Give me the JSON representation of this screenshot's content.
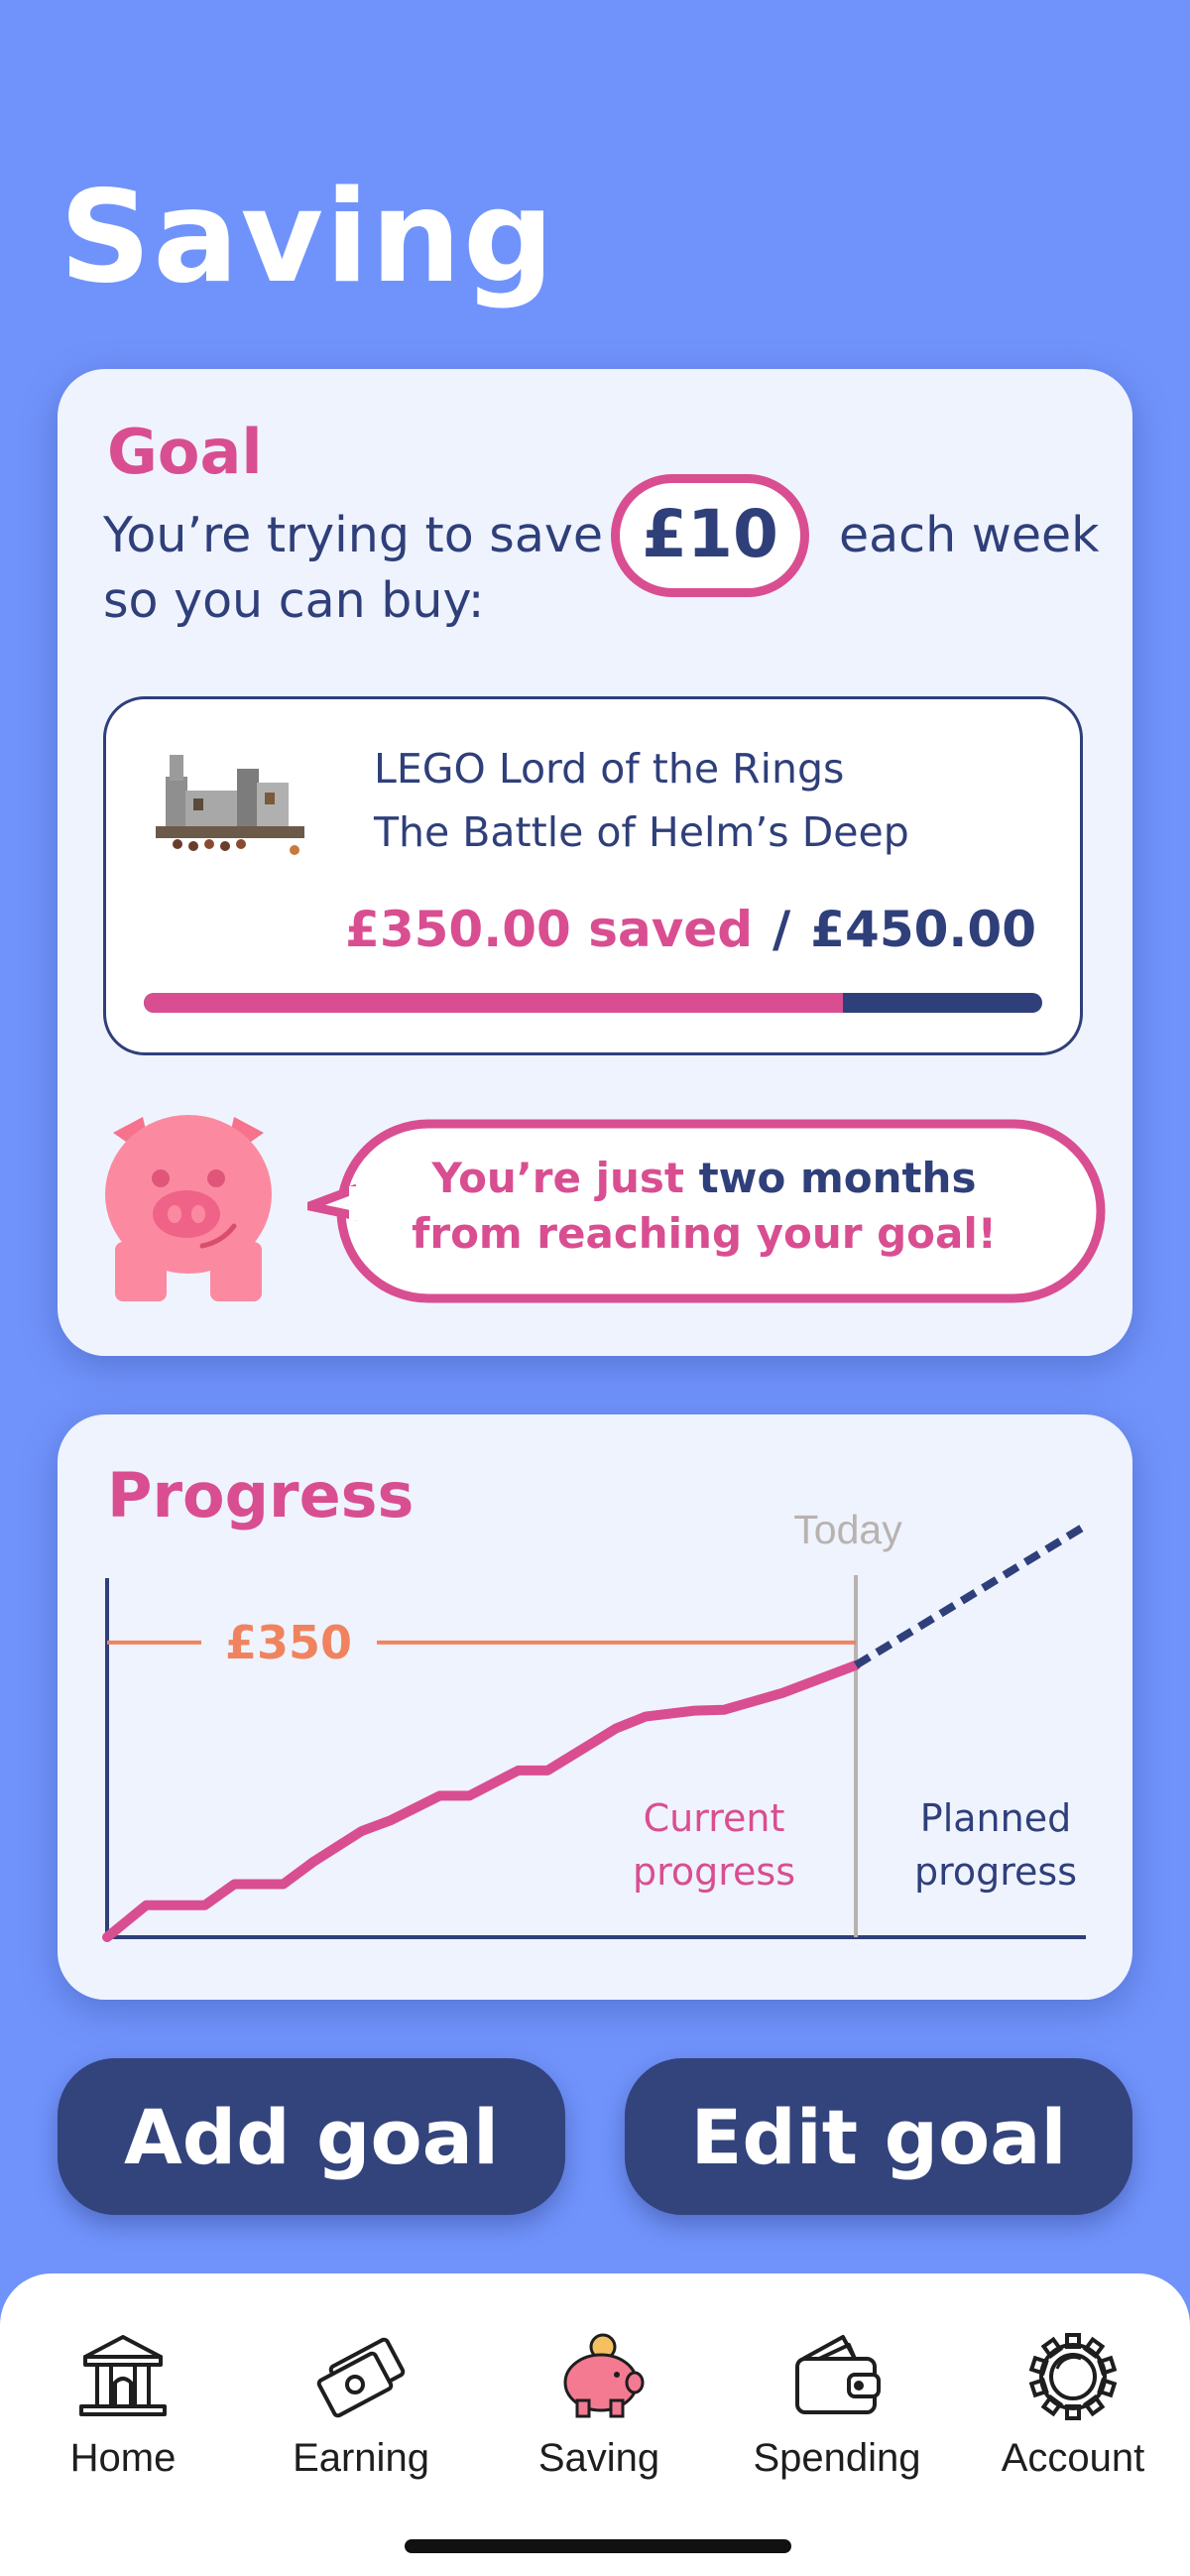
{
  "page": {
    "title": "Saving"
  },
  "goal": {
    "heading": "Goal",
    "line1_prefix": "You’re trying to save",
    "weekly_amount": "£10",
    "line1_suffix": "each week",
    "line2": "so you can buy:",
    "item": {
      "name_line1": "LEGO Lord of the Rings",
      "name_line2": "The Battle of Helm’s Deep",
      "saved_text": "£350.00 saved",
      "separator": "/",
      "target_text": "£450.00",
      "progress_fraction": 0.7778
    },
    "message": {
      "part1": "You’re just ",
      "part2": "two months",
      "part3": "from reaching your goal!"
    }
  },
  "progress": {
    "heading": "Progress",
    "today_label": "Today",
    "current_label_1": "Current",
    "current_label_2": "progress",
    "planned_label_1": "Planned",
    "planned_label_2": "progress"
  },
  "chart_data": {
    "type": "line",
    "title": "",
    "xlabel": "",
    "ylabel": "",
    "ylim": [
      0,
      450
    ],
    "xlim": [
      0,
      100
    ],
    "reference_line": {
      "value": 350,
      "label": "£350"
    },
    "today_x": 76.5,
    "series": [
      {
        "name": "Current progress",
        "style": "solid",
        "x": [
          0,
          4,
          10,
          13,
          18,
          21,
          26,
          29,
          34,
          37,
          42,
          45,
          52,
          55,
          60,
          63,
          69,
          76.5
        ],
        "y": [
          0,
          38,
          38,
          63,
          63,
          89,
          126,
          139,
          168,
          168,
          198,
          198,
          248,
          262,
          269,
          270,
          290,
          323
        ]
      },
      {
        "name": "Planned progress",
        "style": "dashed",
        "x": [
          76.5,
          100
        ],
        "y": [
          323,
          489
        ]
      }
    ]
  },
  "actions": {
    "add_goal": "Add goal",
    "edit_goal": "Edit goal"
  },
  "tabs": [
    {
      "label": "Home",
      "icon": "bank-icon"
    },
    {
      "label": "Earning",
      "icon": "cash-icon"
    },
    {
      "label": "Saving",
      "icon": "piggy-bank-icon"
    },
    {
      "label": "Spending",
      "icon": "wallet-icon"
    },
    {
      "label": "Account",
      "icon": "gear-icon"
    }
  ],
  "colors": {
    "background": "#7093fb",
    "card": "#eff3fe",
    "pink": "#d94e91",
    "navy": "#2f3f7a",
    "orange": "#f0835f",
    "today_gray": "#b8b2b0"
  }
}
